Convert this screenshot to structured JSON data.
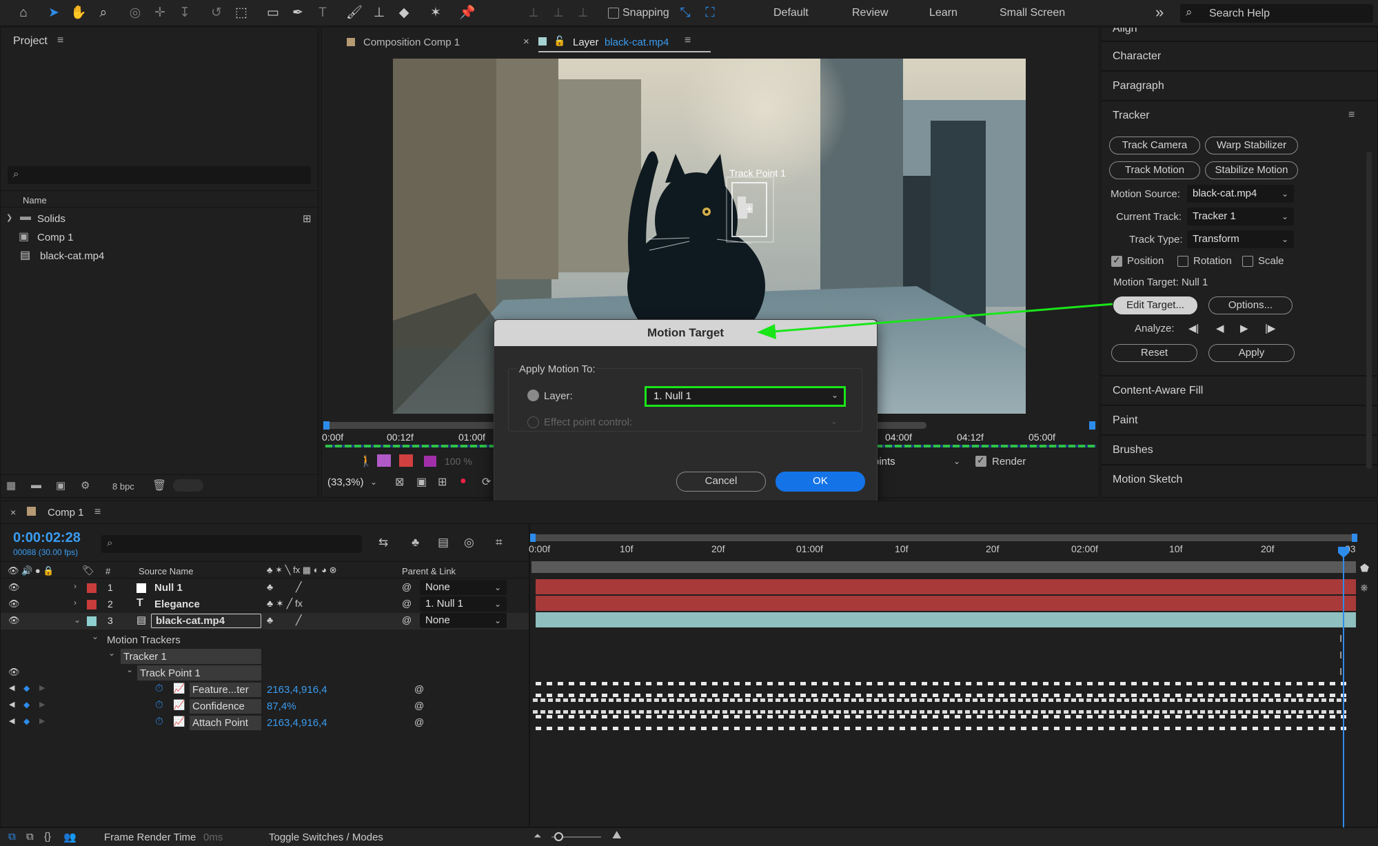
{
  "toolbar": {
    "tools": [
      "home-icon",
      "selection-tool-icon",
      "hand-tool-icon",
      "zoom-tool-icon",
      "orbit-camera-icon",
      "pan-camera-icon",
      "dolly-camera-icon",
      "rotation-tool-icon",
      "pan-behind-icon",
      "rectangle-tool-icon",
      "pen-tool-icon",
      "type-tool-icon",
      "brush-tool-icon",
      "clone-stamp-icon",
      "eraser-icon",
      "roto-brush-icon",
      "puppet-pin-icon"
    ],
    "snapping_label": "Snapping",
    "workspaces": [
      "Default",
      "Review",
      "Learn",
      "Small Screen"
    ],
    "more": "»",
    "search_placeholder": "Search Help"
  },
  "project": {
    "title": "Project",
    "column_name": "Name",
    "items": [
      {
        "name": "Solids",
        "icon": "folder-icon"
      },
      {
        "name": "Comp 1",
        "icon": "composition-icon"
      },
      {
        "name": "black-cat.mp4",
        "icon": "footage-icon"
      }
    ],
    "bpc": "8 bpc"
  },
  "viewer": {
    "tabs": [
      {
        "label": "Composition Comp 1",
        "prefix": "",
        "file": ""
      },
      {
        "label": "Layer",
        "file": "black-cat.mp4"
      }
    ],
    "track_point_label": "Track Point 1",
    "ruler": [
      "0:00f",
      "00:12f",
      "01:00f",
      "04:00f",
      "04:12f",
      "05:00f"
    ],
    "zoom": "(33,3%)",
    "view_percent": "100 %",
    "points_select": "oints",
    "render_label": "Render"
  },
  "dialog": {
    "title": "Motion Target",
    "group_label": "Apply Motion To:",
    "layer_label": "Layer:",
    "layer_value": "1. Null 1",
    "effect_label": "Effect point control:",
    "cancel": "Cancel",
    "ok": "OK",
    "highlight_color": "#19e619",
    "ok_color": "#1473e6"
  },
  "right_panel": {
    "sections_top": [
      "Align",
      "Character",
      "Paragraph"
    ],
    "tracker": {
      "title": "Tracker",
      "buttons": [
        "Track Camera",
        "Warp Stabilizer",
        "Track Motion",
        "Stabilize Motion"
      ],
      "motion_source_label": "Motion Source:",
      "motion_source_value": "black-cat.mp4",
      "current_track_label": "Current Track:",
      "current_track_value": "Tracker 1",
      "track_type_label": "Track Type:",
      "track_type_value": "Transform",
      "position_label": "Position",
      "rotation_label": "Rotation",
      "scale_label": "Scale",
      "position_checked": true,
      "rotation_checked": false,
      "scale_checked": false,
      "motion_target": "Motion Target: Null 1",
      "edit_target": "Edit Target...",
      "options": "Options...",
      "analyze_label": "Analyze:",
      "reset": "Reset",
      "apply": "Apply"
    },
    "sections_bottom": [
      "Content-Aware Fill",
      "Paint",
      "Brushes",
      "Motion Sketch"
    ]
  },
  "timeline": {
    "comp_tab": "Comp 1",
    "timecode": "0:00:02:28",
    "frames": "00088 (30.00 fps)",
    "col_num": "#",
    "col_source": "Source Name",
    "col_parent": "Parent & Link",
    "layers": [
      {
        "num": "1",
        "name": "Null 1",
        "parent": "None",
        "color": "#c83c3c",
        "type": "null"
      },
      {
        "num": "2",
        "name": "Elegance",
        "parent": "1. Null 1",
        "color": "#c83c3c",
        "type": "text"
      },
      {
        "num": "3",
        "name": "black-cat.mp4",
        "parent": "None",
        "color": "#8ecfcf",
        "type": "footage"
      }
    ],
    "sub": {
      "motion_trackers": "Motion Trackers",
      "tracker": "Tracker 1",
      "track_point": "Track Point 1",
      "props": [
        {
          "name": "Feature...ter",
          "value": "2163,4,916,4"
        },
        {
          "name": "Confidence",
          "value": "87,4%"
        },
        {
          "name": "Attach Point",
          "value": "2163,4,916,4"
        }
      ]
    },
    "ruler": [
      "0:00f",
      "10f",
      "20f",
      "01:00f",
      "10f",
      "20f",
      "02:00f",
      "10f",
      "20f",
      "03"
    ],
    "bottom": {
      "render_time_label": "Frame Render Time",
      "render_time_value": "0ms",
      "toggle": "Toggle Switches / Modes"
    }
  }
}
